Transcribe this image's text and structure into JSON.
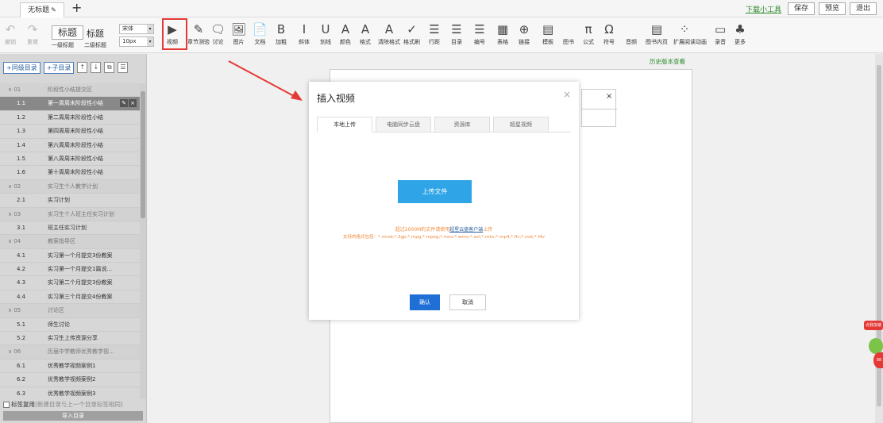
{
  "topbar": {
    "tab_title": "无标题",
    "add_tab": "+",
    "download_tool": "下载小工具",
    "save": "保存",
    "preview": "预览",
    "exit": "退出"
  },
  "toolbar": {
    "undo": "撤销",
    "redo": "重做",
    "h1_big": "标题",
    "h2_big": "标题",
    "h1_label": "一级标题",
    "h2_label": "二级标题",
    "font_family": "宋体",
    "font_size": "10px",
    "items": [
      {
        "icon": "video-icon",
        "glyph": "▶",
        "label": "视频"
      },
      {
        "icon": "chapter-test-icon",
        "glyph": "✎",
        "label": "章节测验"
      },
      {
        "icon": "discussion-icon",
        "glyph": "🗨",
        "label": "讨论"
      },
      {
        "icon": "image-icon",
        "glyph": "🖼",
        "label": "图片"
      },
      {
        "icon": "document-icon",
        "glyph": "📄",
        "label": "文档"
      },
      {
        "icon": "bold-icon",
        "glyph": "B",
        "label": "加粗"
      },
      {
        "icon": "italic-icon",
        "glyph": "I",
        "label": "斜体"
      },
      {
        "icon": "underline-icon",
        "glyph": "U",
        "label": "划线"
      },
      {
        "icon": "font-color-icon",
        "glyph": "A",
        "label": "颜色"
      },
      {
        "icon": "format-icon",
        "glyph": "A",
        "label": "格式"
      },
      {
        "icon": "clear-format-icon",
        "glyph": "A",
        "label": "清除格式"
      },
      {
        "icon": "format-painter-icon",
        "glyph": "✓",
        "label": "格式刷"
      },
      {
        "icon": "line-height-icon",
        "glyph": "☰",
        "label": "行距"
      },
      {
        "icon": "toc-icon",
        "glyph": "☰",
        "label": "目录"
      },
      {
        "icon": "numbering-icon",
        "glyph": "☰",
        "label": "编号"
      },
      {
        "icon": "table-icon",
        "glyph": "▦",
        "label": "表格"
      },
      {
        "icon": "link-icon",
        "glyph": "⊕",
        "label": "链接"
      },
      {
        "icon": "template-icon",
        "glyph": "▤",
        "label": "模板"
      },
      {
        "icon": "book-icon",
        "glyph": "",
        "label": "图书"
      },
      {
        "icon": "formula-icon",
        "glyph": "π",
        "label": "公式"
      },
      {
        "icon": "symbol-icon",
        "glyph": "Ω",
        "label": "符号"
      },
      {
        "icon": "audio-icon",
        "glyph": "",
        "label": "音频"
      },
      {
        "icon": "book-page-icon",
        "glyph": "▤",
        "label": "图书内页"
      },
      {
        "icon": "extend-read-icon",
        "glyph": "⁘",
        "label": "扩展阅读"
      },
      {
        "icon": "animation-icon",
        "glyph": "",
        "label": "动画"
      },
      {
        "icon": "record-icon",
        "glyph": "▭",
        "label": "录音"
      },
      {
        "icon": "more-icon",
        "glyph": "♣",
        "label": "更多"
      }
    ]
  },
  "left_panel": {
    "add_chapter": "+同级目录",
    "add_sub": "+子目录",
    "tag_reuse": "标签复用",
    "tag_hint": "(新建目录与上一个目录标签相同)",
    "import_btn": "导入目录",
    "toc": [
      {
        "num": "∨ 01",
        "text": "阶段性小结提交区",
        "type": "sec"
      },
      {
        "num": "1.1",
        "text": "第一周周末阶段性小结",
        "type": "active"
      },
      {
        "num": "1.2",
        "text": "第二周周末阶段性小结",
        "type": "item"
      },
      {
        "num": "1.3",
        "text": "第四周周末阶段性小结",
        "type": "item"
      },
      {
        "num": "1.4",
        "text": "第六周周末阶段性小结",
        "type": "item"
      },
      {
        "num": "1.5",
        "text": "第八周周末阶段性小结",
        "type": "item"
      },
      {
        "num": "1.6",
        "text": "第十周周末阶段性小结",
        "type": "item"
      },
      {
        "num": "∨ 02",
        "text": "实习生个人教学计划",
        "type": "sec"
      },
      {
        "num": "2.1",
        "text": "实习计划",
        "type": "item"
      },
      {
        "num": "∨ 03",
        "text": "实习生个人班主任实习计划",
        "type": "sec"
      },
      {
        "num": "3.1",
        "text": "班主任实习计划",
        "type": "item"
      },
      {
        "num": "∨ 04",
        "text": "教案指导区",
        "type": "sec"
      },
      {
        "num": "4.1",
        "text": "实习第一个月提交3份教案",
        "type": "item"
      },
      {
        "num": "4.2",
        "text": "实习第一个月提交1篇说...",
        "type": "item"
      },
      {
        "num": "4.3",
        "text": "实习第二个月提交3份教案",
        "type": "item"
      },
      {
        "num": "4.4",
        "text": "实习第三个月提交4份教案",
        "type": "item"
      },
      {
        "num": "∨ 05",
        "text": "讨论区",
        "type": "sec"
      },
      {
        "num": "5.1",
        "text": "师生讨论",
        "type": "item"
      },
      {
        "num": "5.2",
        "text": "实习生上传资源分享",
        "type": "item"
      },
      {
        "num": "∨ 06",
        "text": "历届中学教师优秀教学视...",
        "type": "sec"
      },
      {
        "num": "6.1",
        "text": "优秀教学视频案例1",
        "type": "item"
      },
      {
        "num": "6.2",
        "text": "优秀教学视频案例2",
        "type": "item"
      },
      {
        "num": "6.3",
        "text": "优秀教学视频案例3",
        "type": "item"
      }
    ]
  },
  "editor": {
    "history": "历史版本查看"
  },
  "modal": {
    "title": "插入视频",
    "close": "×",
    "tabs": [
      "本地上传",
      "电脑同步云盘",
      "资源库",
      "超星视频"
    ],
    "upload_button": "上传文件",
    "notice_prefix": "超过2000M的文件请使用",
    "notice_link": "超星云盘客户端",
    "notice_suffix": "上传",
    "formats": "支持的格式包括：*.rmvb;*.3gp;*.mpg;*.mpeg;*.mov;*.wmv;*.avi;*.mkv;*.mp4;*.flv;*.vob;*.f4v",
    "confirm": "确认",
    "cancel": "取消"
  },
  "float_widget": {
    "label": "点我加速",
    "badge": "88"
  }
}
